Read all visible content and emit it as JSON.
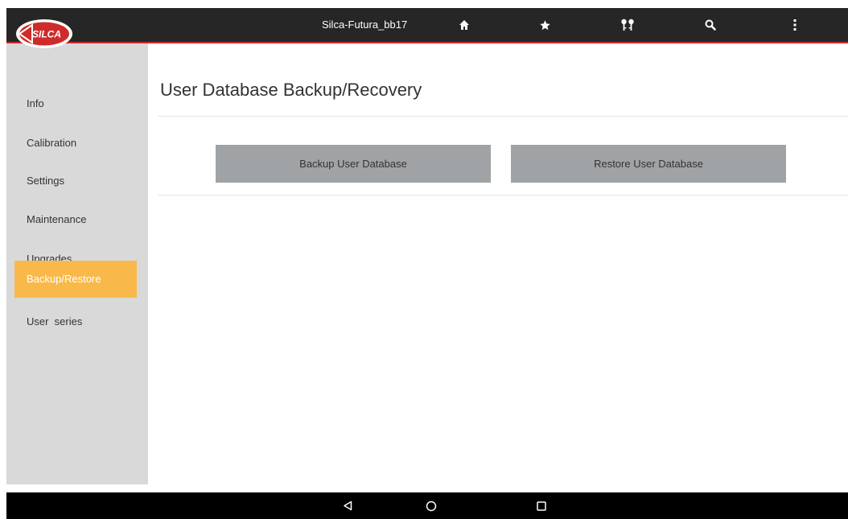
{
  "app": {
    "title": "Silca-Futura_bb17",
    "logo_text": "SILCA"
  },
  "toolbar": {
    "icons": [
      "home-icon",
      "star-icon",
      "keys-icon",
      "search-icon",
      "more-vert-icon"
    ]
  },
  "sidebar": {
    "items": [
      {
        "label": "Info",
        "active": false
      },
      {
        "label": "Calibration",
        "active": false
      },
      {
        "label": "Settings",
        "active": false
      },
      {
        "label": "Maintenance",
        "active": false
      },
      {
        "label": "Upgrades",
        "active": false
      },
      {
        "label": "Backup/Restore",
        "active": true
      },
      {
        "label": "User  series",
        "active": false
      }
    ]
  },
  "main": {
    "title": "User Database Backup/Recovery",
    "backup_label": "Backup User Database",
    "restore_label": "Restore User Database"
  },
  "system_nav": {
    "icons": [
      "back-icon",
      "home-circle-icon",
      "recents-icon"
    ]
  },
  "colors": {
    "topbar": "#262626",
    "accent_line": "#cf2b2b",
    "sidebar_bg": "#d9d9d9",
    "active_item": "#f9b94a",
    "button_bg": "#a0a3a5",
    "logo_red": "#cf2b2b"
  }
}
